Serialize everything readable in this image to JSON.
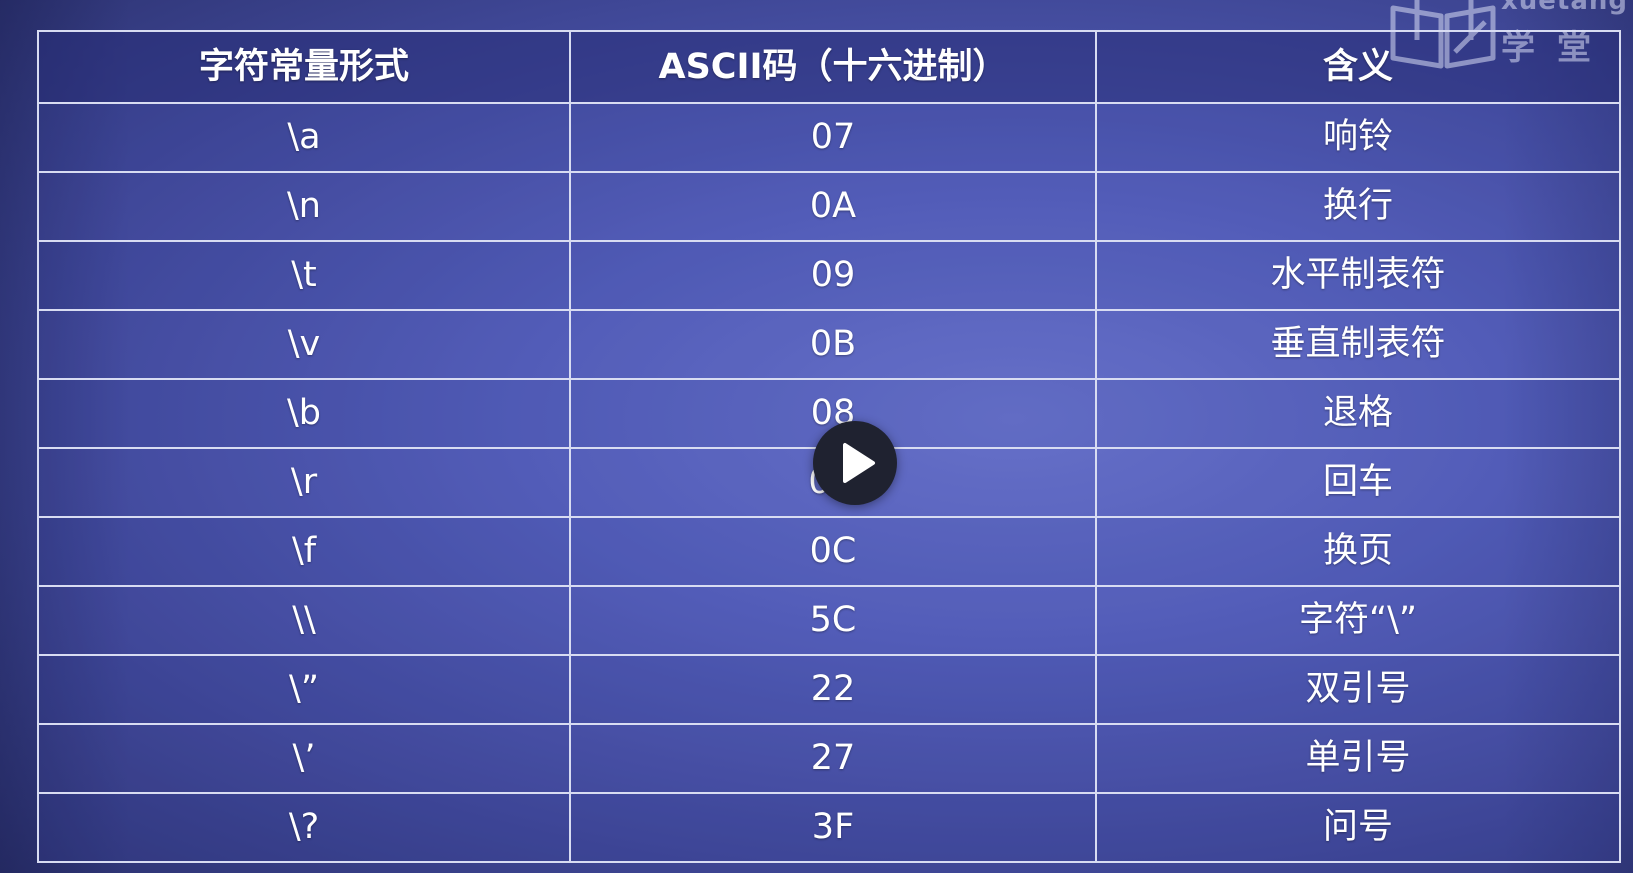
{
  "watermark": {
    "text_latin": "xuetang",
    "text_cn": "学堂"
  },
  "table": {
    "headers": [
      "字符常量形式",
      "ASCII码（十六进制）",
      "含义"
    ],
    "rows": [
      {
        "form": "\\a",
        "ascii": "07",
        "meaning": "响铃"
      },
      {
        "form": "\\n",
        "ascii": "0A",
        "meaning": "换行"
      },
      {
        "form": "\\t",
        "ascii": "09",
        "meaning": "水平制表符"
      },
      {
        "form": "\\v",
        "ascii": "0B",
        "meaning": "垂直制表符"
      },
      {
        "form": "\\b",
        "ascii": "08",
        "meaning": "退格"
      },
      {
        "form": "\\r",
        "ascii": "0D",
        "meaning": "回车"
      },
      {
        "form": "\\f",
        "ascii": "0C",
        "meaning": "换页"
      },
      {
        "form": "\\\\",
        "ascii": "5C",
        "meaning": "字符“\\”"
      },
      {
        "form": "\\”",
        "ascii": "22",
        "meaning": "双引号"
      },
      {
        "form": "\\’",
        "ascii": "27",
        "meaning": "单引号"
      },
      {
        "form": "\\?",
        "ascii": "3F",
        "meaning": "问号"
      }
    ]
  },
  "player": {
    "play_icon": "play-icon",
    "accent": "#1f2230"
  }
}
